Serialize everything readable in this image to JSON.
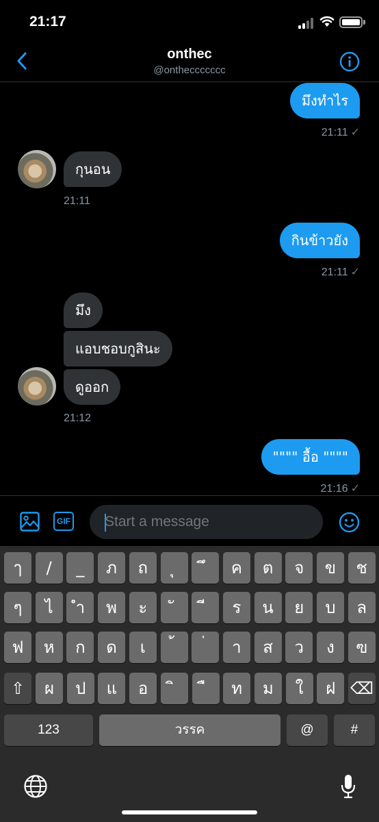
{
  "status_bar": {
    "time": "21:17"
  },
  "header": {
    "name": "onthec",
    "handle": "@ontheccccccc"
  },
  "messages": [
    {
      "text": "มึงทำไร",
      "time": "21:11",
      "check": "✓"
    },
    {
      "text": "กุนอน",
      "time": "21:11"
    },
    {
      "text": "กินข้าวยัง",
      "time": "21:11",
      "check": "✓"
    },
    {
      "text": "มึง"
    },
    {
      "text": "แอบชอบกูสินะ"
    },
    {
      "text": "ดูออก",
      "time": "21:12"
    },
    {
      "text": "\"\"\"\" อื้อ \"\"\"\"",
      "time": "21:16",
      "check": "✓"
    }
  ],
  "composer": {
    "placeholder": "Start a message",
    "gif_label": "GIF"
  },
  "keyboard": {
    "rows": [
      [
        "ๅ",
        "/",
        "_",
        "ภ",
        "ถ",
        "ุ",
        "ึ",
        "ค",
        "ต",
        "จ",
        "ข",
        "ช"
      ],
      [
        "ๆ",
        "ไ",
        "ำ",
        "พ",
        "ะ",
        "ั",
        "ี",
        "ร",
        "น",
        "ย",
        "บ",
        "ล"
      ],
      [
        "ฟ",
        "ห",
        "ก",
        "ด",
        "เ",
        "้",
        "่",
        "า",
        "ส",
        "ว",
        "ง",
        "ฃ"
      ],
      [
        "ผ",
        "ป",
        "แ",
        "อ",
        "ิ",
        "ื",
        "ท",
        "ม",
        "ใ",
        "ฝ"
      ]
    ],
    "shift": "⇧",
    "delete": "⌫",
    "numbers": "123",
    "space": "วรรค",
    "at": "@",
    "hash": "#"
  }
}
